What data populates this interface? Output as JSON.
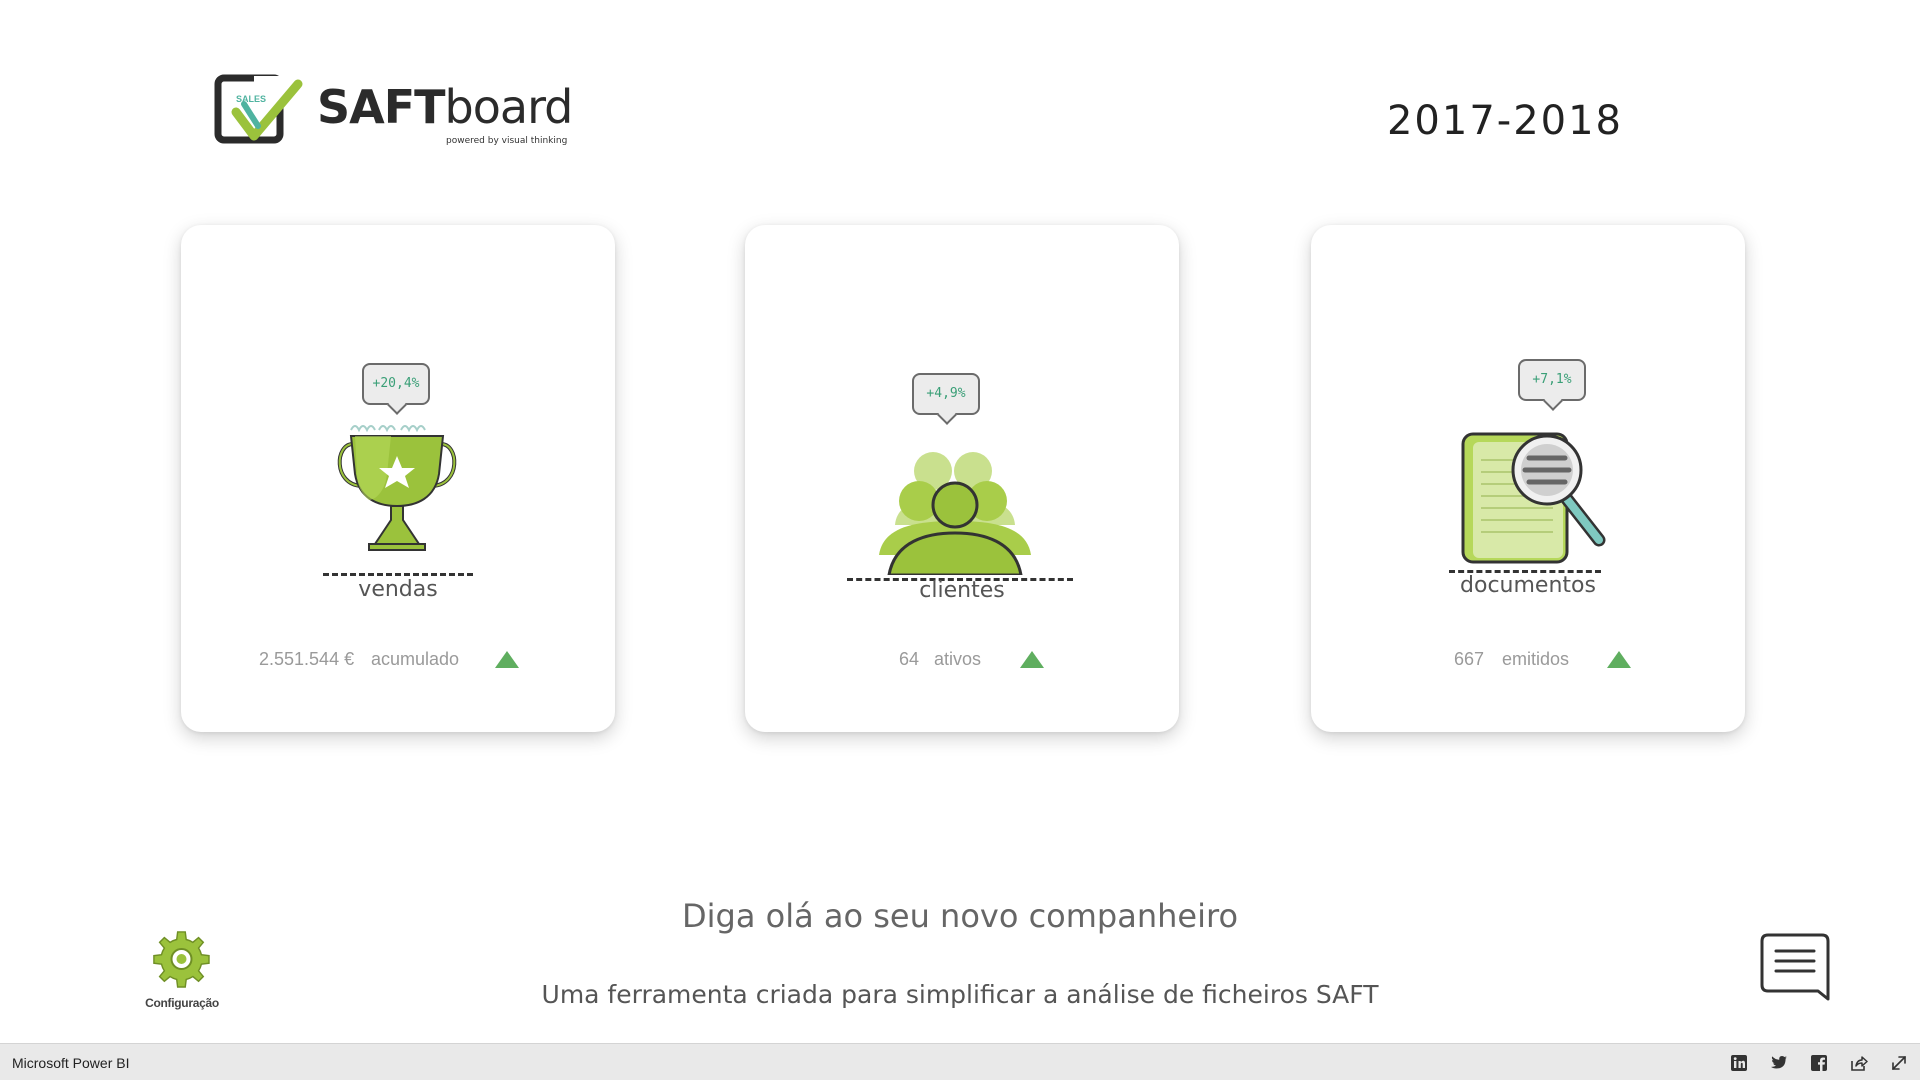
{
  "header": {
    "logo": {
      "badge": "SALES",
      "name_bold": "SAFT",
      "name_light": "board",
      "tagline": "powered by visual thinking"
    },
    "period": "2017-2018"
  },
  "cards": [
    {
      "title": "vendas",
      "change": "+20,4%",
      "value": "2.551.544 €",
      "value_label": "acumulado",
      "trend": "up",
      "icon": "trophy-icon"
    },
    {
      "title": "clientes",
      "change": "+4,9%",
      "value": "64",
      "value_label": "ativos",
      "trend": "up",
      "icon": "people-icon"
    },
    {
      "title": "documentos",
      "change": "+7,1%",
      "value": "667",
      "value_label": "emitidos",
      "trend": "up",
      "icon": "document-search-icon"
    }
  ],
  "footer": {
    "headline": "Diga olá ao seu novo companheiro",
    "subline": "Uma ferramenta criada para simplificar a análise de ficheiros SAFT",
    "config_label": "Configuração"
  },
  "statusbar": {
    "app_name": "Microsoft Power BI",
    "icons": [
      "linkedin-icon",
      "twitter-icon",
      "facebook-icon",
      "share-icon",
      "fullscreen-icon"
    ]
  },
  "colors": {
    "accent_green": "#9bc23c",
    "trend_up": "#5fae5f",
    "change_text": "#3a9f77"
  }
}
